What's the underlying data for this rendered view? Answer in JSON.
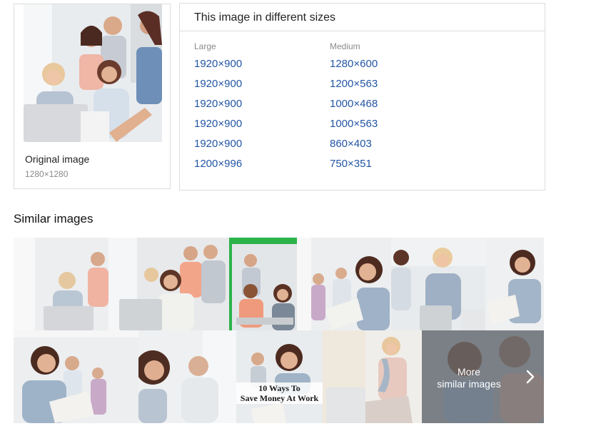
{
  "original": {
    "label": "Original image",
    "dimensions": "1280×1280"
  },
  "sizes": {
    "title": "This image in different sizes",
    "large": {
      "header": "Large",
      "items": [
        "1920×900",
        "1920×900",
        "1920×900",
        "1920×900",
        "1920×900",
        "1200×996"
      ]
    },
    "medium": {
      "header": "Medium",
      "items": [
        "1280×600",
        "1200×563",
        "1000×468",
        "1000×563",
        "860×403",
        "750×351"
      ]
    }
  },
  "similar": {
    "title": "Similar images",
    "overlay_line1": "10 Ways To",
    "overlay_line2": "Save Money At Work",
    "more_line1": "More",
    "more_line2": "similar images"
  },
  "colors": {
    "link": "#2255a4",
    "border": "#dcdcdc",
    "green_bar": "#2bb34a"
  }
}
